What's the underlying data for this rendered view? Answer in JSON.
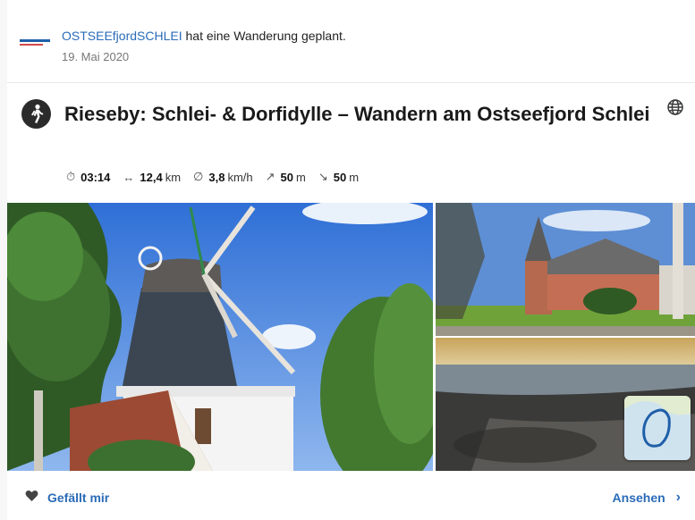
{
  "post": {
    "author": "OSTSEEfjordSCHLEI",
    "action": "hat eine Wanderung geplant.",
    "date": "19. Mai 2020"
  },
  "tour": {
    "title": "Rieseby: Schlei- & Dorfidylle – Wandern am Ostseefjord Schlei",
    "activity_icon": "hiking-icon",
    "privacy_icon": "globe-icon",
    "stats": {
      "duration": {
        "icon": "stopwatch-icon",
        "value": "03:14",
        "unit": ""
      },
      "distance": {
        "icon": "distance-icon",
        "value": "12,4",
        "unit": "km"
      },
      "speed": {
        "icon": "average-speed-icon",
        "value": "3,8",
        "unit": "km/h"
      },
      "uphill": {
        "icon": "uphill-icon",
        "value": "50",
        "unit": "m"
      },
      "downhill": {
        "icon": "downhill-icon",
        "value": "50",
        "unit": "m"
      }
    }
  },
  "footer": {
    "like_label": "Gefällt mir",
    "view_label": "Ansehen"
  },
  "colors": {
    "link": "#2a6bb8",
    "text": "#1b1b1b",
    "muted": "#777777"
  }
}
